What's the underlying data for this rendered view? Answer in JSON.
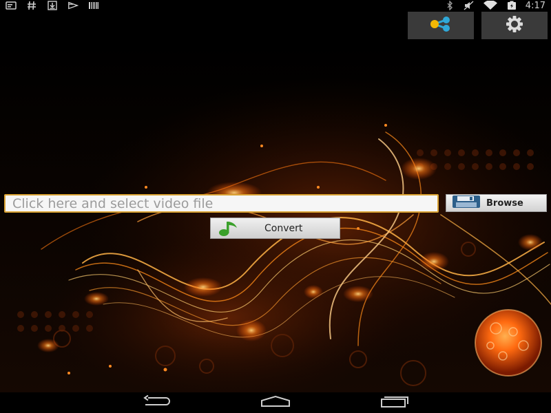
{
  "status_bar": {
    "left_icons": [
      "notification-icon",
      "hash-icon",
      "download-icon",
      "play-icon",
      "barcode-icon"
    ],
    "right_icons": [
      "bluetooth-icon",
      "silent-icon",
      "wifi-icon",
      "battery-charging-icon"
    ],
    "time": "4:17"
  },
  "action_bar": {
    "share_icon": "share-icon",
    "settings_icon": "gear-icon"
  },
  "main": {
    "file_placeholder": "Click here and select video file",
    "browse_label": "Browse",
    "browse_icon": "floppy-disk-icon",
    "convert_label": "Convert",
    "convert_icon": "music-note-icon"
  },
  "nav_bar": {
    "icons": [
      "back-icon",
      "home-icon",
      "recents-icon"
    ]
  },
  "colors": {
    "accent_border": "#d9a233",
    "share_blue": "#2fa8d8",
    "share_yellow": "#f2b705",
    "music_green": "#3aa02a"
  }
}
